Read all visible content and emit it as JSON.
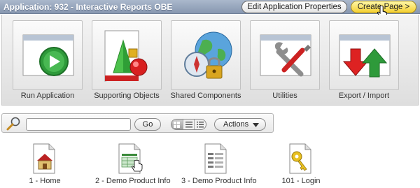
{
  "header": {
    "app_title": "Application: 932 - Interactive Reports OBE",
    "edit_button": "Edit Application Properties",
    "create_button": "Create Page >"
  },
  "tiles": [
    {
      "label": "Run Application",
      "icon": "run-application-icon"
    },
    {
      "label": "Supporting Objects",
      "icon": "supporting-objects-icon"
    },
    {
      "label": "Shared Components",
      "icon": "shared-components-icon"
    },
    {
      "label": "Utilities",
      "icon": "utilities-icon"
    },
    {
      "label": "Export / Import",
      "icon": "export-import-icon"
    }
  ],
  "search": {
    "value": "",
    "go_label": "Go",
    "actions_label": "Actions"
  },
  "pages": [
    {
      "label": "1 - Home",
      "icon": "home-page-icon"
    },
    {
      "label": "2 - Demo Product Info",
      "icon": "report-page-icon"
    },
    {
      "label": "3 - Demo Product Info",
      "icon": "form-page-icon"
    },
    {
      "label": "101 - Login",
      "icon": "login-page-icon"
    }
  ]
}
